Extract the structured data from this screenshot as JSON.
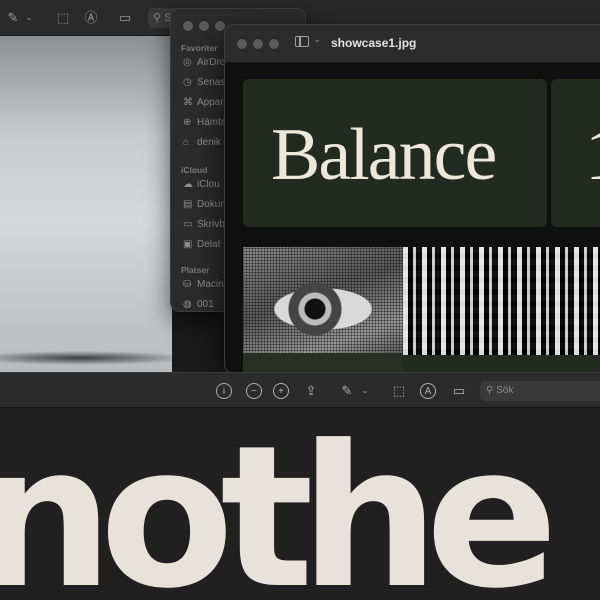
{
  "back_window": {
    "search_label": "S"
  },
  "finder_sidebar": {
    "sections": [
      {
        "header": "Favoriter",
        "items": [
          {
            "label": "AirDrop",
            "icon": "airdrop-icon"
          },
          {
            "label": "Senas",
            "icon": "clock-icon"
          },
          {
            "label": "Appar",
            "icon": "apps-icon"
          },
          {
            "label": "Hämta",
            "icon": "download-icon"
          },
          {
            "label": "denik",
            "icon": "home-icon"
          }
        ]
      },
      {
        "header": "iCloud",
        "items": [
          {
            "label": "iClou",
            "icon": "cloud-icon"
          },
          {
            "label": "Dokum",
            "icon": "document-icon"
          },
          {
            "label": "Skrivb",
            "icon": "desktop-icon"
          },
          {
            "label": "Delat",
            "icon": "shared-folder-icon"
          }
        ]
      },
      {
        "header": "Platser",
        "items": [
          {
            "label": "Macin",
            "icon": "disk-icon"
          },
          {
            "label": "001",
            "icon": "globe-icon"
          }
        ]
      }
    ]
  },
  "preview_window": {
    "title": "showcase1.jpg",
    "balance_text": "Balance",
    "second_card_glyph": "1"
  },
  "bottom_toolbar": {
    "search_placeholder": "Sök"
  },
  "big_text": "nothe"
}
